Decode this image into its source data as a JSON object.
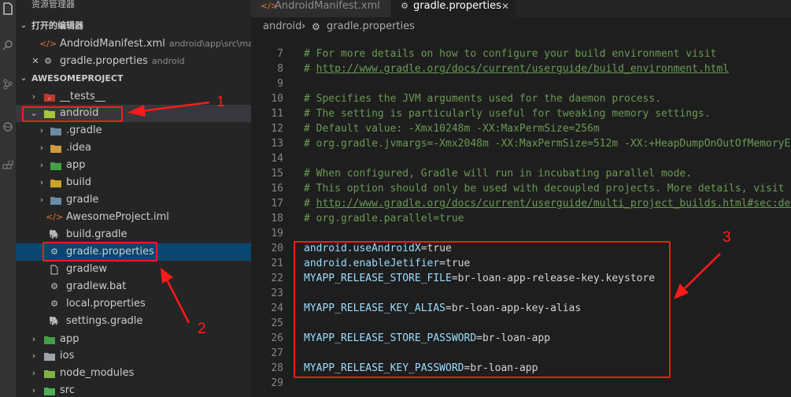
{
  "explorer": {
    "title": "资源管理器",
    "open_editors": {
      "title": "打开的编辑器",
      "items": [
        {
          "icon": "xml-icon",
          "name": "AndroidManifest.xml",
          "desc": "android\\app\\src\\main"
        },
        {
          "icon": "gear-icon",
          "name": "gradle.properties",
          "desc": "android"
        }
      ]
    },
    "project": {
      "title": "AWESOMEPROJECT",
      "items": [
        {
          "name": "__tests__"
        },
        {
          "name": "android"
        },
        {
          "name": ".gradle"
        },
        {
          "name": ".idea"
        },
        {
          "name": "app"
        },
        {
          "name": "build"
        },
        {
          "name": "gradle"
        },
        {
          "name": "AwesomeProject.iml"
        },
        {
          "name": "build.gradle"
        },
        {
          "name": "gradle.properties"
        },
        {
          "name": "gradlew"
        },
        {
          "name": "gradlew.bat"
        },
        {
          "name": "local.properties"
        },
        {
          "name": "settings.gradle"
        },
        {
          "name": "app"
        },
        {
          "name": "ios"
        },
        {
          "name": "node_modules"
        },
        {
          "name": "src"
        }
      ]
    }
  },
  "tabs": [
    {
      "name": "AndroidManifest.xml",
      "active": false
    },
    {
      "name": "gradle.properties",
      "active": true
    }
  ],
  "breadcrumb": {
    "folder": "android",
    "file": "gradle.properties"
  },
  "editor": {
    "lines": [
      {
        "n": "7",
        "type": "comment",
        "text": "# For more details on how to configure your build environment visit"
      },
      {
        "n": "8",
        "type": "link",
        "prefix": "# ",
        "text": "http://www.gradle.org/docs/current/userguide/build_environment.html"
      },
      {
        "n": "9",
        "type": "empty",
        "text": ""
      },
      {
        "n": "10",
        "type": "comment",
        "text": "# Specifies the JVM arguments used for the daemon process."
      },
      {
        "n": "11",
        "type": "comment",
        "text": "# The setting is particularly useful for tweaking memory settings."
      },
      {
        "n": "12",
        "type": "comment",
        "text": "# Default value: -Xmx10248m -XX:MaxPermSize=256m"
      },
      {
        "n": "13",
        "type": "comment",
        "text": "# org.gradle.jvmargs=-Xmx2048m -XX:MaxPermSize=512m -XX:+HeapDumpOnOutOfMemoryErr"
      },
      {
        "n": "14",
        "type": "empty",
        "text": ""
      },
      {
        "n": "15",
        "type": "comment",
        "text": "# When configured, Gradle will run in incubating parallel mode."
      },
      {
        "n": "16",
        "type": "comment",
        "text": "# This option should only be used with decoupled projects. More details, visit"
      },
      {
        "n": "17",
        "type": "link",
        "prefix": "# ",
        "text": "http://www.gradle.org/docs/current/userguide/multi_project_builds.html#sec:decc"
      },
      {
        "n": "18",
        "type": "comment",
        "text": "# org.gradle.parallel=true"
      },
      {
        "n": "19",
        "type": "empty",
        "text": ""
      },
      {
        "n": "20",
        "type": "kv",
        "key": "android.useAndroidX",
        "value": "=true"
      },
      {
        "n": "21",
        "type": "kv",
        "key": "android.enableJetifier",
        "value": "=true"
      },
      {
        "n": "22",
        "type": "kv",
        "key": "MYAPP_RELEASE_STORE_FILE",
        "value": "=br-loan-app-release-key.keystore"
      },
      {
        "n": "23",
        "type": "empty",
        "text": ""
      },
      {
        "n": "24",
        "type": "kv",
        "key": "MYAPP_RELEASE_KEY_ALIAS",
        "value": "=br-loan-app-key-alias"
      },
      {
        "n": "25",
        "type": "empty",
        "text": ""
      },
      {
        "n": "26",
        "type": "kv",
        "key": "MYAPP_RELEASE_STORE_PASSWORD",
        "value": "=br-loan-app"
      },
      {
        "n": "27",
        "type": "empty",
        "text": ""
      },
      {
        "n": "28",
        "type": "kv",
        "key": "MYAPP_RELEASE_KEY_PASSWORD",
        "value": "=br-loan-app"
      },
      {
        "n": "29",
        "type": "empty",
        "text": ""
      }
    ]
  },
  "annotations": {
    "label1": "1",
    "label2": "2",
    "label3": "3",
    "color": "#ff1a1a"
  },
  "colors": {
    "selection": "#094771",
    "comment": "#6a9955",
    "key": "#9cdcfe"
  }
}
